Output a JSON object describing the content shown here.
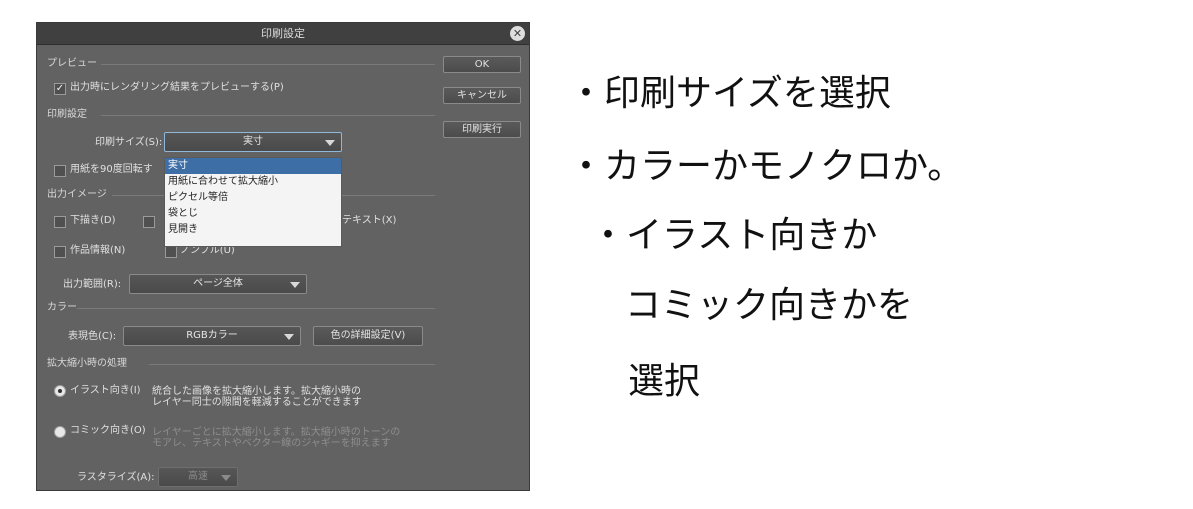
{
  "dialog": {
    "title": "印刷設定",
    "close_glyph": "✕",
    "buttons": {
      "ok": "OK",
      "cancel": "キャンセル",
      "print": "印刷実行"
    },
    "preview": {
      "section": "プレビュー",
      "render_preview_label": "出力時にレンダリング結果をプレビューする(P)",
      "render_preview_checked": true
    },
    "print_settings": {
      "section": "印刷設定",
      "size_label": "印刷サイズ(S):",
      "size_value": "実寸",
      "size_options": [
        "実寸",
        "用紙に合わせて拡大縮小",
        "ピクセル等倍",
        "袋とじ",
        "見開き"
      ],
      "rotate_label": "用紙を90度回転す"
    },
    "output_image": {
      "section": "出力イメージ",
      "draft_label": "下描き(D)",
      "text_label": "テキスト(X)",
      "work_info_label": "作品情報(N)",
      "nombre_label": "ノンブル(U)",
      "range_label": "出力範囲(R):",
      "range_value": "ページ全体"
    },
    "color": {
      "section": "カラー",
      "expression_label": "表現色(C):",
      "expression_value": "RGBカラー",
      "detail_button": "色の詳細設定(V)"
    },
    "scaling": {
      "section": "拡大縮小時の処理",
      "illust_label": "イラスト向き(I)",
      "illust_desc_1": "統合した画像を拡大縮小します。拡大縮小時の",
      "illust_desc_2": "レイヤー同士の隙間を軽減することができます",
      "comic_label": "コミック向き(O)",
      "comic_desc_1": "レイヤーごとに拡大縮小します。拡大縮小時のトーンの",
      "comic_desc_2": "モアレ、テキストやベクター線のジャギーを抑えます",
      "rasterize_label": "ラスタライズ(A):",
      "rasterize_value": "高速"
    }
  },
  "notes": {
    "line1": "・印刷サイズを選択",
    "line2": "・カラーかモノクロか。",
    "line3": "・イラスト向きか",
    "line4": "コミック向きかを",
    "line5": "選択"
  }
}
